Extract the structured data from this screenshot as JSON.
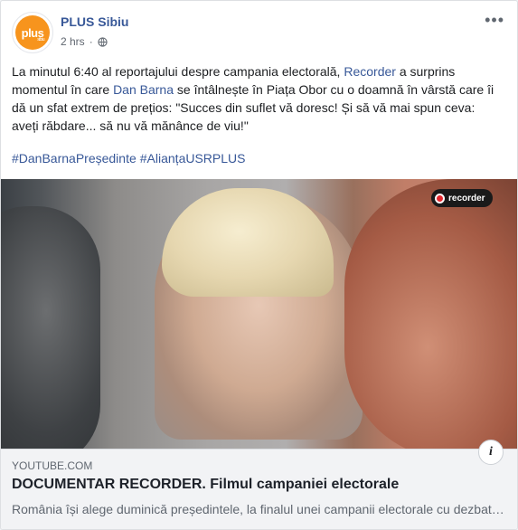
{
  "post": {
    "author": "PLUS Sibiu",
    "avatar_text": "plus",
    "avatar_subtext": "sibiu",
    "time": "2 hrs",
    "privacy_icon": "globe-icon",
    "more_icon": "more-icon",
    "text_part1": "La minutul 6:40 al reportajului despre campania electorală, ",
    "link1": "Recorder",
    "text_part2": " a surprins momentul în care ",
    "link2": "Dan Barna",
    "text_part3": " se întâlnește în Piața Obor cu o doamnă în vârstă care îi dă un sfat extrem de prețios: \"Succes din suflet vă doresc! Și să vă mai spun ceva: aveți răbdare... să nu vă mănânce de viu!\"",
    "hashtags": [
      "#DanBarnaPreședinte",
      "#AlianțaUSRPLUS"
    ]
  },
  "video": {
    "badge_label": "recorder"
  },
  "link_preview": {
    "domain": "YOUTUBE.COM",
    "title": "DOCUMENTAR RECORDER. Filmul campaniei electorale",
    "description": "România își alege duminică președintele, la finalul unei campanii electorale cu dezbateri ratate",
    "info_icon": "info-icon"
  },
  "colors": {
    "link": "#385898",
    "avatar_bg": "#f7941d",
    "recorder_dot": "#e3262d"
  }
}
